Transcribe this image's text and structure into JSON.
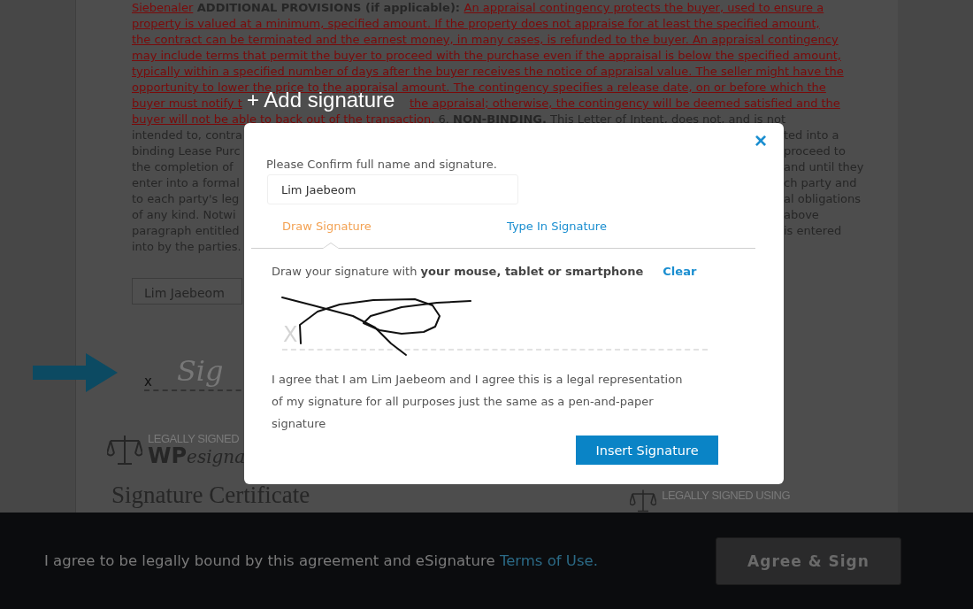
{
  "document": {
    "lines": [
      {
        "kind": "full",
        "left": [
          {
            "kind": "inserted",
            "text": "Siebenaler"
          },
          {
            "kind": "bold",
            "text": " ADDITIONAL PROVISIONS (if applicable): "
          },
          {
            "kind": "inserted",
            "text": "An appraisal contingency protects the buyer, used to ensure a"
          }
        ]
      },
      {
        "kind": "full",
        "left": [
          {
            "kind": "inserted",
            "text": "property is valued at a minimum, specified amount. If the property does not appraise for at least the specified amount,"
          }
        ]
      },
      {
        "kind": "full",
        "left": [
          {
            "kind": "inserted",
            "text": "the contract can be terminated and the earnest money, in many cases, is refunded to the buyer. An appraisal contingency"
          }
        ]
      },
      {
        "kind": "full",
        "left": [
          {
            "kind": "inserted",
            "text": "may include terms that permit the buyer to proceed with the purchase even if the appraisal is below the specified amount,"
          }
        ]
      },
      {
        "kind": "full",
        "left": [
          {
            "kind": "inserted",
            "text": "typically within a specified number of days after the buyer receives the notice of appraisal value. The seller might have the"
          }
        ]
      },
      {
        "kind": "full",
        "left": [
          {
            "kind": "inserted",
            "text": "opportunity to lower the price to the appraisal amount. The contingency specifies a release date, on or before which the"
          }
        ]
      },
      {
        "kind": "split",
        "left": [
          {
            "kind": "inserted",
            "text": "buyer must notify t"
          }
        ],
        "right": [
          {
            "kind": "inserted",
            "text": "the appraisal; otherwise, the contingency will be deemed satisfied and the"
          }
        ]
      },
      {
        "kind": "full",
        "left": [
          {
            "kind": "inserted",
            "text": "buyer will not be able to back out of the transaction."
          },
          {
            "kind": "plain",
            "text": " 6. "
          },
          {
            "kind": "bold",
            "text": "NON-BINDING."
          },
          {
            "kind": "plain",
            "text": " This Letter of Intent, does not, and is not"
          }
        ]
      },
      {
        "kind": "cut",
        "left": [
          {
            "kind": "plain",
            "text": "intended to, contra"
          }
        ],
        "right": [
          {
            "kind": "plain",
            "text": "ted into a"
          }
        ]
      },
      {
        "kind": "cut",
        "left": [
          {
            "kind": "plain",
            "text": "binding Lease Purc"
          }
        ],
        "right": [
          {
            "kind": "plain",
            "text": "proceed to"
          }
        ]
      },
      {
        "kind": "cut",
        "left": [
          {
            "kind": "plain",
            "text": "the completion of"
          }
        ],
        "right": [
          {
            "kind": "plain",
            "text": "and until they"
          }
        ]
      },
      {
        "kind": "cut",
        "left": [
          {
            "kind": "plain",
            "text": "enter into a formal"
          }
        ],
        "right": [
          {
            "kind": "plain",
            "text": "ch party and"
          }
        ]
      },
      {
        "kind": "cut",
        "left": [
          {
            "kind": "plain",
            "text": "to each party's leg"
          }
        ],
        "right": [
          {
            "kind": "plain",
            "text": "al obligations"
          }
        ]
      },
      {
        "kind": "cut",
        "left": [
          {
            "kind": "plain",
            "text": "of any kind. Notwi"
          }
        ],
        "right": [
          {
            "kind": "plain",
            "text": "above"
          }
        ]
      },
      {
        "kind": "cut",
        "left": [
          {
            "kind": "plain",
            "text": "paragraph entitled"
          }
        ],
        "right": [
          {
            "kind": "plain",
            "text": "is entered"
          }
        ]
      },
      {
        "kind": "full",
        "left": [
          {
            "kind": "plain",
            "text": "into by the parties."
          }
        ]
      }
    ],
    "name_field": {
      "value": "Lim Jaebeom"
    },
    "signature_line": {
      "mark": "x",
      "placeholder": "Sig"
    },
    "logo": {
      "caption": "LEGALLY SIGNED",
      "brand_bold": "WP",
      "brand_script": "esigna"
    },
    "certificate_title": "Signature Certificate",
    "logo_right": {
      "caption": "LEGALLY SIGNED USING"
    }
  },
  "dialog": {
    "heading": "+ Add signature",
    "close": "×",
    "prompt": "Please Confirm full name and signature.",
    "name_value": "Lim Jaebeom",
    "tabs": [
      {
        "label": "Draw Signature",
        "selected": true
      },
      {
        "label": "Type In Signature",
        "selected": false
      }
    ],
    "instruction": "Draw your signature with **your mouse, tablet or smartphone**",
    "clear": "Clear",
    "pad_mark": "X",
    "agreement": "I agree that I am Lim Jaebeom and I agree this is a legal representation of my signature for all purposes just the same as a pen-and-paper signature",
    "insert_button": "Insert Signature"
  },
  "footer": {
    "text": "I agree to be legally bound by this agreement and eSignature ",
    "link": "Terms of Use.",
    "button": "Agree & Sign"
  }
}
